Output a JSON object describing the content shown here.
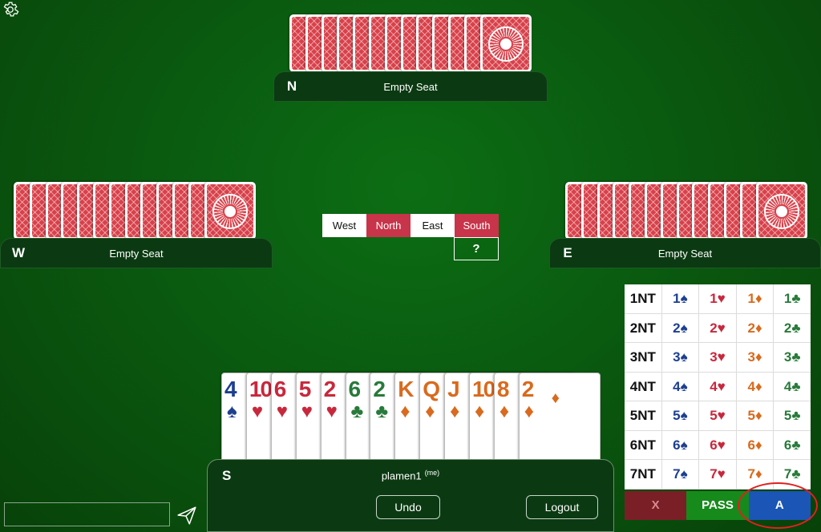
{
  "north": {
    "dir": "N",
    "name": "Empty Seat"
  },
  "west": {
    "dir": "W",
    "name": "Empty Seat"
  },
  "east": {
    "dir": "E",
    "name": "Empty Seat"
  },
  "bidding": {
    "headers": [
      "West",
      "North",
      "East",
      "South"
    ],
    "vulnerable": [
      false,
      true,
      false,
      true
    ],
    "current": "?"
  },
  "south": {
    "dir": "S",
    "name": "plamen1",
    "me_tag": "(me)",
    "undo_label": "Undo",
    "logout_label": "Logout"
  },
  "hand": [
    {
      "rank": "4",
      "suit": "♠",
      "color": "spade"
    },
    {
      "rank": "10",
      "suit": "♥",
      "color": "heart"
    },
    {
      "rank": "6",
      "suit": "♥",
      "color": "heart"
    },
    {
      "rank": "5",
      "suit": "♥",
      "color": "heart"
    },
    {
      "rank": "2",
      "suit": "♥",
      "color": "heart"
    },
    {
      "rank": "6",
      "suit": "♣",
      "color": "club"
    },
    {
      "rank": "2",
      "suit": "♣",
      "color": "club"
    },
    {
      "rank": "K",
      "suit": "♦",
      "color": "diam"
    },
    {
      "rank": "Q",
      "suit": "♦",
      "color": "diam"
    },
    {
      "rank": "J",
      "suit": "♦",
      "color": "diam"
    },
    {
      "rank": "10",
      "suit": "♦",
      "color": "diam"
    },
    {
      "rank": "8",
      "suit": "♦",
      "color": "diam"
    },
    {
      "rank": "2",
      "suit": "♦",
      "color": "diam"
    }
  ],
  "bidbox": {
    "levels": [
      "1",
      "2",
      "3",
      "4",
      "5",
      "6",
      "7"
    ],
    "strains": [
      {
        "label": "NT",
        "color": "#111111"
      },
      {
        "label": "♠",
        "color": "#1d3f8f"
      },
      {
        "label": "♥",
        "color": "#c8283c"
      },
      {
        "label": "♦",
        "color": "#d96a1e"
      },
      {
        "label": "♣",
        "color": "#287a3a"
      }
    ],
    "double_label": "X",
    "pass_label": "PASS",
    "alert_label": "A"
  },
  "chat": {
    "placeholder": ""
  },
  "icons": {
    "settings": "gear-icon",
    "send": "send-icon"
  }
}
